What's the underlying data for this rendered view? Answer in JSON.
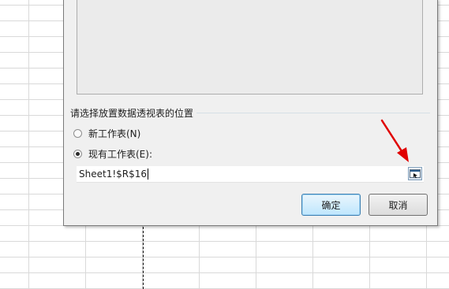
{
  "placement": {
    "group_label": "请选择放置数据透视表的位置",
    "option_new": "新工作表(N)",
    "option_existing": "现有工作表(E):",
    "selected": "existing",
    "location_value": "Sheet1!$R$16"
  },
  "buttons": {
    "ok": "确定",
    "cancel": "取消"
  },
  "icons": {
    "collapse": "range-select-icon",
    "annotation": "red-arrow-icon"
  },
  "colors": {
    "annotation_arrow": "#e00000",
    "default_button": "#bee6fd"
  }
}
